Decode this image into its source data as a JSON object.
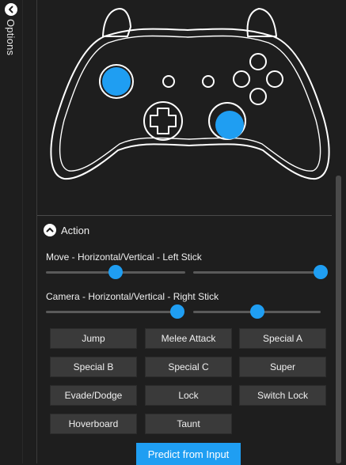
{
  "sidebar": {
    "options_label": "Options",
    "options_icon": "chevron-left-icon"
  },
  "action_section": {
    "title": "Action",
    "collapse_icon": "chevron-up-icon",
    "sliders": [
      {
        "label": "Move - Horizontal/Vertical - Left Stick",
        "horizontal_value": 0.5,
        "vertical_value": 1.0
      },
      {
        "label": "Camera - Horizontal/Vertical - Right Stick",
        "horizontal_value": 1.0,
        "vertical_value": 0.5
      }
    ],
    "buttons": [
      "Jump",
      "Melee Attack",
      "Special A",
      "Special B",
      "Special C",
      "Super",
      "Evade/Dodge",
      "Lock",
      "Switch Lock",
      "Hoverboard",
      "Taunt"
    ],
    "predict_label": "Predict from Input"
  },
  "colors": {
    "accent": "#1f9ef2",
    "background": "#1e1e1e",
    "button": "#3a3a3a"
  }
}
